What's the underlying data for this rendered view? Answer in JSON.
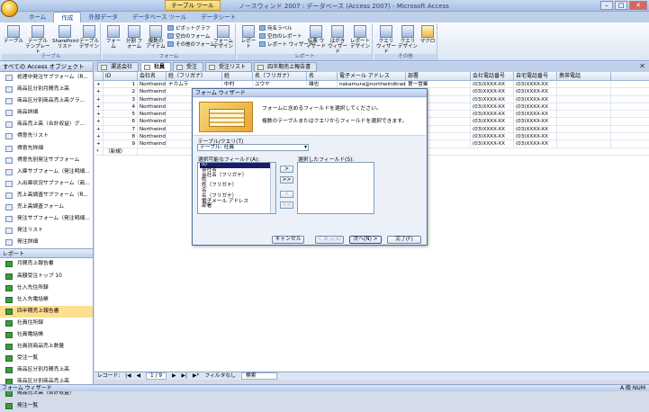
{
  "window": {
    "title": "ノースウィンド 2007 : データベース (Access 2007) - Microsoft Access",
    "tool_badge": "テーブル ツール"
  },
  "tabs": [
    "ホーム",
    "作成",
    "外部データ",
    "データベース ツール",
    "データシート"
  ],
  "ribbon": {
    "groups": [
      {
        "label": "テーブル"
      },
      {
        "label": "フォーム"
      },
      {
        "label": "レポート"
      },
      {
        "label": "その他"
      }
    ],
    "table_buttons": [
      "テーブル",
      "テーブル テンプレート",
      "SharePoint リスト",
      "テーブル デザイン"
    ],
    "form_buttons": [
      "フォーム",
      "分割 フォーム",
      "複数の アイテム"
    ],
    "form_small": [
      "ピボットグラフ",
      "空白のフォーム",
      "その他のフォーム",
      "フォーム デザイン"
    ],
    "report_buttons": [
      "レポート"
    ],
    "report_small": [
      "宛名ラベル",
      "空白のレポート",
      "レポート ウィザード"
    ],
    "report_big": [
      "伝票 ウィザード",
      "はがき ウィザード",
      "レポート デザイン"
    ],
    "other_buttons": [
      "クエリ ウィザード",
      "クエリ デザイン",
      "マクロ"
    ]
  },
  "nav": {
    "header": "すべての Access オブジェクト",
    "items": [
      "処理中発注サブフォーム（R...",
      "商品区分別月間売上高",
      "商品区分別商品売上高グラ...",
      "商品詳細",
      "商品売上高（合計収益）グ...",
      "得意先リスト",
      "得意先詳細",
      "得意先別発注サブフォーム",
      "入庫サブフォーム（発注明細...",
      "入出庫状況サブフォーム（商...",
      "売上高調査サブフォーム（R...",
      "売上高調査フォーム",
      "発注サブフォーム（発注明細...",
      "発注リスト",
      "発注詳細"
    ],
    "report_header": "レポート",
    "reports": [
      "月間売上報告書",
      "高額受注トップ 10",
      "仕入先住所録",
      "仕入先電話帳",
      "四半期売上報告書",
      "社員住所録",
      "社員電話帳",
      "社員別商品売上数量",
      "受注一覧",
      "商品区分別月間売上高",
      "商品区分別商品売上高",
      "商品売上高（合計収益）",
      "発注一覧"
    ],
    "selected_report": "四半期売上報告書"
  },
  "doc_tabs": [
    "運送会社",
    "社員",
    "受注",
    "受注リスト",
    "四半期売上報告書"
  ],
  "active_doc_tab": "社員",
  "sheet": {
    "columns": [
      "ID",
      "会社名",
      "姓（フリガナ）",
      "姓",
      "名（フリガナ）",
      "名",
      "電子メール アドレス",
      "部署",
      "会社電話番号",
      "自宅電話番号",
      "携帯電話"
    ],
    "rows": [
      {
        "id": "1",
        "company": "Northwind Tra",
        "furi_sei": "ナカムラ",
        "sei": "中村",
        "furi_mei": "ユウヤ",
        "mei": "雄也",
        "email": "nakamura@northwindtraders",
        "dept": "第一営業",
        "phone": "(03)XXXX-XX",
        "home": "(03)XXXX-XX"
      },
      {
        "id": "2",
        "company": "Northwind Tra",
        "furi_sei": "",
        "sei": "",
        "furi_mei": "",
        "mei": "",
        "email": "@northwindtraders",
        "dept": "第一営業",
        "phone": "(03)XXXX-XX",
        "home": "(03)XXXX-XX"
      },
      {
        "id": "3",
        "company": "Northwind Tra",
        "furi_sei": "",
        "sei": "",
        "furi_mei": "",
        "mei": "",
        "email": "@northwindtr",
        "dept": "営業開発",
        "phone": "(03)XXXX-XX",
        "home": "(03)XXXX-XX"
      },
      {
        "id": "4",
        "company": "Northwind Tra",
        "furi_sei": "",
        "sei": "",
        "furi_mei": "",
        "mei": "",
        "email": "@northwindtr",
        "dept": "第一営業",
        "phone": "(03)XXXX-XX",
        "home": "(03)XXXX-XX"
      },
      {
        "id": "5",
        "company": "Northwind Tra",
        "furi_sei": "",
        "sei": "",
        "furi_mei": "",
        "mei": "",
        "email": "@northwindtr",
        "dept": "営業開発",
        "phone": "(03)XXXX-XX",
        "home": "(03)XXXX-XX"
      },
      {
        "id": "6",
        "company": "Northwind Tra",
        "furi_sei": "",
        "sei": "",
        "furi_mei": "",
        "mei": "",
        "email": "@northwindtr",
        "dept": "第一営業",
        "phone": "(03)XXXX-XX",
        "home": "(03)XXXX-XX"
      },
      {
        "id": "7",
        "company": "Northwind Tra",
        "furi_sei": "",
        "sei": "",
        "furi_mei": "",
        "mei": "",
        "email": "northwind.co.",
        "dept": "第一営業",
        "phone": "(03)XXXX-XX",
        "home": "(03)XXXX-XX"
      },
      {
        "id": "8",
        "company": "Northwind Tra",
        "furi_sei": "",
        "sei": "",
        "furi_mei": "",
        "mei": "",
        "email": "northwindtrade",
        "dept": "第二営業",
        "phone": "(03)XXXX-XX",
        "home": "(03)XXXX-XX"
      },
      {
        "id": "9",
        "company": "Northwind Tra",
        "furi_sei": "",
        "sei": "",
        "furi_mei": "",
        "mei": "",
        "email": "northwindtrade",
        "dept": "第一営業",
        "phone": "(03)XXXX-XX",
        "home": "(03)XXXX-XX"
      }
    ],
    "new_row_label": "（新規）"
  },
  "record_nav": {
    "label": "レコード:",
    "position": "1 / 9",
    "filter": "フィルタなし",
    "search": "検索"
  },
  "status": {
    "left": "フォーム ウィザード",
    "right": "A 般 NUM"
  },
  "dialog": {
    "title": "フォーム ウィザード",
    "line1": "フォームに含めるフィールドを選択してください。",
    "line2": "複数のテーブルまたはクエリからフィールドを選択できます。",
    "table_label": "テーブル/クエリ(T)",
    "table_value": "テーブル: 社員",
    "available_label": "選択可能なフィールド(A):",
    "selected_label": "選択したフィールド(S):",
    "fields": [
      "ID",
      "会社名",
      "会社名（フリガナ）",
      "姓",
      "姓（フリガナ）",
      "名",
      "名（フリガナ）",
      "電子メール アドレス",
      "部署"
    ],
    "move_buttons": [
      ">",
      ">>",
      "<",
      "<<"
    ],
    "buttons": [
      "キャンセル",
      "< 戻る(B)",
      "次へ(N) >",
      "完了(F)"
    ]
  }
}
